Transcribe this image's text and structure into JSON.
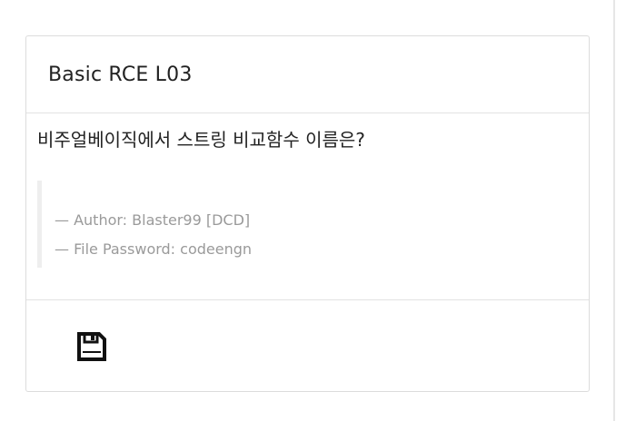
{
  "card": {
    "title": "Basic RCE L03",
    "question": "비주얼베이직에서 스트링 비교함수 이름은?",
    "author_line": "— Author: Blaster99 [DCD]",
    "password_line": "— File Password: codeengn"
  },
  "footer": {
    "save_icon": "floppy-disk-icon"
  }
}
